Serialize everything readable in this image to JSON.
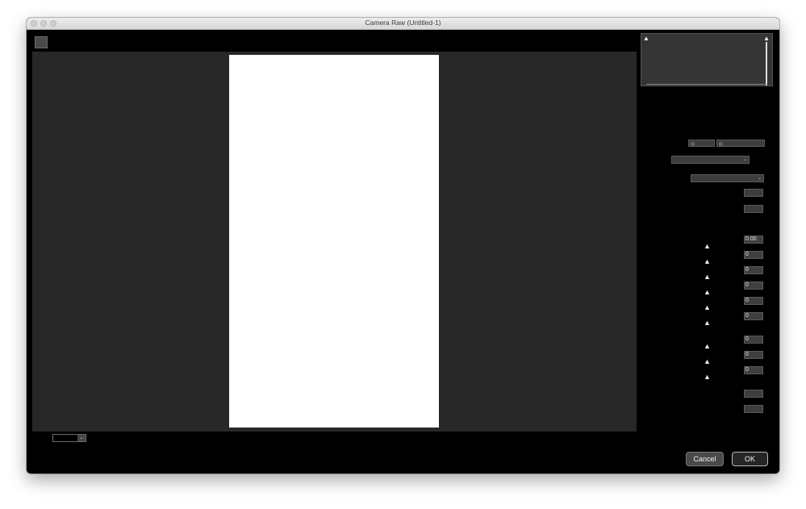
{
  "window": {
    "title": "Camera Raw (Untitled-1)"
  },
  "zoom": {
    "value": ""
  },
  "histogram": {
    "shadow_clip_icon": "triangle-icon",
    "highlight_clip_icon": "triangle-icon"
  },
  "basic_panel": {
    "values": [
      "0.00",
      "0",
      "0",
      "0",
      "0",
      "0",
      "0",
      "0",
      "0"
    ]
  },
  "buttons": {
    "cancel": "Cancel",
    "ok": "OK"
  }
}
